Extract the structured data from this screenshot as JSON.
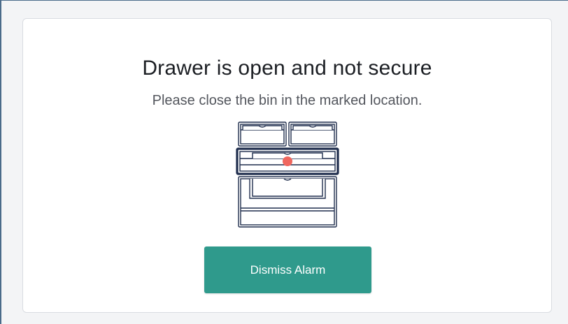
{
  "alert": {
    "title": "Drawer is open and not secure",
    "message": "Please close the bin in the marked location."
  },
  "illustration": {
    "icon": "drawer-cabinet-icon",
    "marker_icon": "location-marker-icon",
    "marker_color": "#f0675e",
    "outline_color": "#1f2d4d",
    "highlighted_drawer": "middle"
  },
  "actions": {
    "dismiss_label": "Dismiss Alarm",
    "dismiss_color": "#2f9a8c"
  }
}
